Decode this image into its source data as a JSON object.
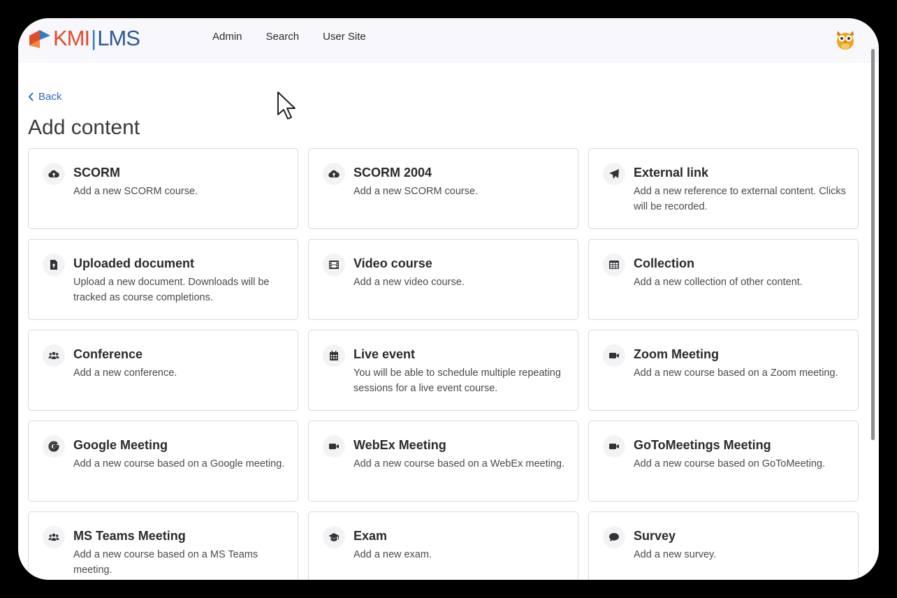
{
  "app": {
    "logo_kmi": "KMI",
    "logo_separator": "|",
    "logo_lms": "LMS",
    "nav": [
      "Admin",
      "Search",
      "User Site"
    ],
    "avatar_icon": "owl-avatar-icon"
  },
  "page": {
    "back_label": "Back",
    "title": "Add content"
  },
  "colors": {
    "accent_link": "#2e6db6",
    "logo_red": "#e34b2b",
    "logo_blue": "#2a5a8f"
  },
  "cards": [
    {
      "icon": "cloud-upload-icon",
      "title": "SCORM",
      "desc": "Add a new SCORM course."
    },
    {
      "icon": "cloud-upload-icon",
      "title": "SCORM 2004",
      "desc": "Add a new SCORM course."
    },
    {
      "icon": "paper-plane-icon",
      "title": "External link",
      "desc": "Add a new reference to external content. Clicks will be recorded."
    },
    {
      "icon": "file-upload-icon",
      "title": "Uploaded document",
      "desc": "Upload a new document. Downloads will be tracked as course completions."
    },
    {
      "icon": "film-icon",
      "title": "Video course",
      "desc": "Add a new video course."
    },
    {
      "icon": "table-grid-icon",
      "title": "Collection",
      "desc": "Add a new collection of other content."
    },
    {
      "icon": "users-icon",
      "title": "Conference",
      "desc": "Add a new conference."
    },
    {
      "icon": "calendar-icon",
      "title": "Live event",
      "desc": "You will be able to schedule multiple repeating sessions for a live event course."
    },
    {
      "icon": "video-camera-icon",
      "title": "Zoom Meeting",
      "desc": "Add a new course based on a Zoom meeting."
    },
    {
      "icon": "google-icon",
      "title": "Google Meeting",
      "desc": "Add a new course based on a Google meeting."
    },
    {
      "icon": "video-camera-icon",
      "title": "WebEx Meeting",
      "desc": "Add a new course based on a WebEx meeting."
    },
    {
      "icon": "video-camera-icon",
      "title": "GoToMeetings Meeting",
      "desc": "Add a new course based on GoToMeeting."
    },
    {
      "icon": "users-icon",
      "title": "MS Teams Meeting",
      "desc": "Add a new course based on a MS Teams meeting."
    },
    {
      "icon": "graduation-cap-icon",
      "title": "Exam",
      "desc": "Add a new exam."
    },
    {
      "icon": "speech-bubble-icon",
      "title": "Survey",
      "desc": "Add a new survey."
    }
  ]
}
